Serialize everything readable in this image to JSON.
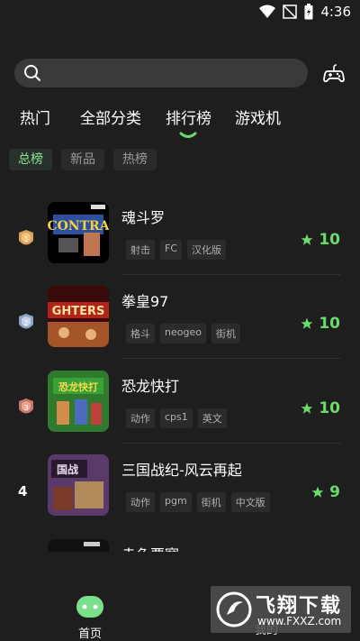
{
  "status_bar": {
    "time": "4:36"
  },
  "search": {
    "placeholder": ""
  },
  "tabs": [
    {
      "label": "热门"
    },
    {
      "label": "全部分类"
    },
    {
      "label": "排行榜"
    },
    {
      "label": "游戏机"
    }
  ],
  "active_tab": "排行榜",
  "subtabs": [
    {
      "label": "总榜"
    },
    {
      "label": "新品"
    },
    {
      "label": "热榜"
    }
  ],
  "active_subtab": "总榜",
  "games": [
    {
      "rank": "1",
      "name": "魂斗罗",
      "tags": [
        "射击",
        "FC",
        "汉化版"
      ],
      "score": "10"
    },
    {
      "rank": "2",
      "name": "拳皇97",
      "tags": [
        "格斗",
        "neogeo",
        "街机"
      ],
      "score": "10"
    },
    {
      "rank": "3",
      "name": "恐龙快打",
      "tags": [
        "动作",
        "cps1",
        "英文"
      ],
      "score": "10"
    },
    {
      "rank": "4",
      "name": "三国战纪-风云再起",
      "tags": [
        "动作",
        "pgm",
        "街机",
        "中文版"
      ],
      "score": "9"
    },
    {
      "rank": "",
      "name": "赤色要塞",
      "tags": [],
      "score": ""
    }
  ],
  "bottom_nav": {
    "home": "首页",
    "mine": "我的"
  },
  "watermark": {
    "title": "飞翔下载",
    "url": "www.FXXZ.com"
  },
  "colors": {
    "accent": "#6bdc6b",
    "background": "#1e1e1e",
    "active_subtab": "#8fe39a"
  }
}
